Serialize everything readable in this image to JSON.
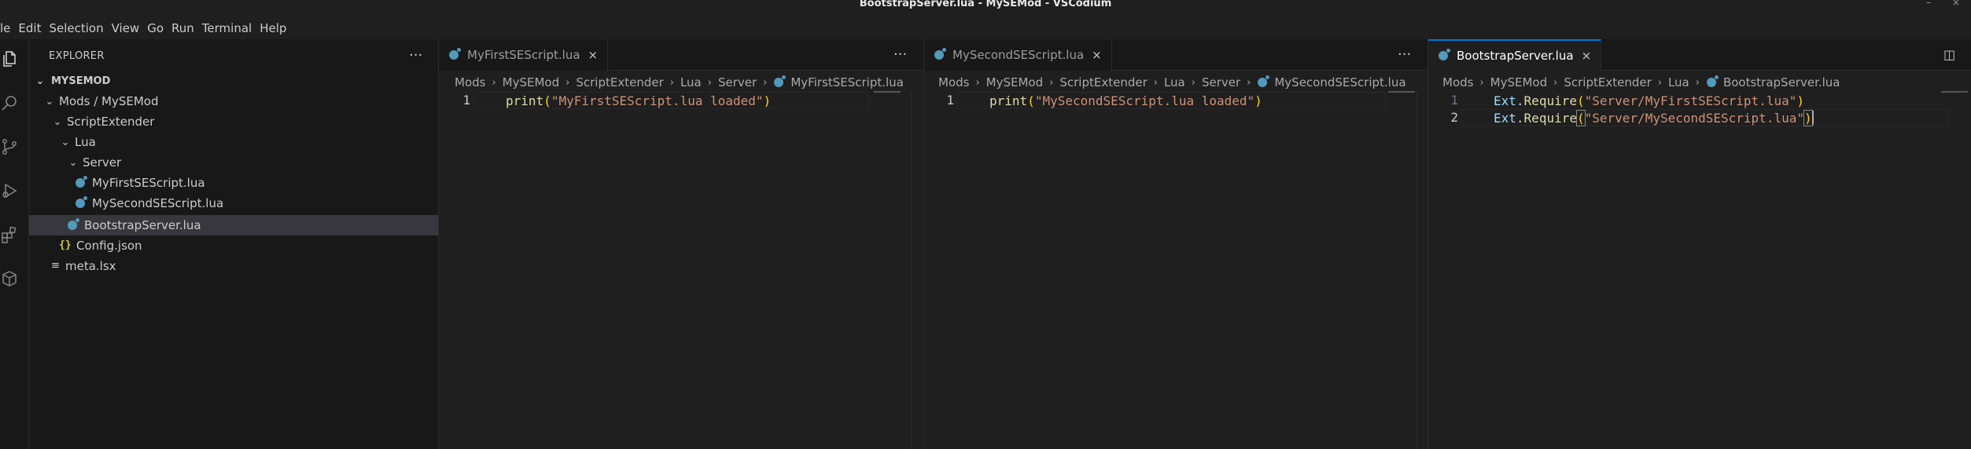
{
  "window": {
    "title": "BootstrapServer.lua - MySEMod - VSCodium",
    "minimize_glyph": "–",
    "close_glyph": "×"
  },
  "menu": [
    "le",
    "Edit",
    "Selection",
    "View",
    "Go",
    "Run",
    "Terminal",
    "Help"
  ],
  "activity_bar": [
    "files-icon",
    "search-icon",
    "source-control-icon",
    "run-debug-icon",
    "extensions-icon",
    "packages-icon"
  ],
  "explorer": {
    "header": "EXPLORER",
    "more": "···",
    "section": "MYSEMOD",
    "items": [
      {
        "label": "Mods / MySEMod",
        "type": "folder"
      },
      {
        "label": "ScriptExtender",
        "type": "folder"
      },
      {
        "label": "Lua",
        "type": "folder"
      },
      {
        "label": "Server",
        "type": "folder"
      },
      {
        "label": "MyFirstSEScript.lua",
        "type": "lua"
      },
      {
        "label": "MySecondSEScript.lua",
        "type": "lua"
      },
      {
        "label": "BootstrapServer.lua",
        "type": "lua",
        "selected": true
      },
      {
        "label": "Config.json",
        "type": "json",
        "icon_text": "{}"
      },
      {
        "label": "meta.lsx",
        "type": "lsx",
        "icon_text": "≡"
      }
    ]
  },
  "editors": [
    {
      "tab": "MyFirstSEScript.lua",
      "close": "×",
      "more": "···",
      "breadcrumbs": [
        "Mods",
        "MySEMod",
        "ScriptExtender",
        "Lua",
        "Server",
        "MyFirstSEScript.lua"
      ],
      "lines": [
        {
          "num": "1",
          "parts": [
            {
              "t": "print",
              "c": "fn"
            },
            {
              "t": "(",
              "c": "punc"
            },
            {
              "t": "\"MyFirstSEScript.lua loaded\"",
              "c": "str"
            },
            {
              "t": ")",
              "c": "punc"
            }
          ]
        }
      ]
    },
    {
      "tab": "MySecondSEScript.lua",
      "close": "×",
      "more": "···",
      "breadcrumbs": [
        "Mods",
        "MySEMod",
        "ScriptExtender",
        "Lua",
        "Server",
        "MySecondSEScript.lua"
      ],
      "lines": [
        {
          "num": "1",
          "parts": [
            {
              "t": "print",
              "c": "fn"
            },
            {
              "t": "(",
              "c": "punc"
            },
            {
              "t": "\"MySecondSEScript.lua loaded\"",
              "c": "str"
            },
            {
              "t": ")",
              "c": "punc"
            }
          ]
        }
      ]
    },
    {
      "tab": "BootstrapServer.lua",
      "close": "×",
      "split": "◫",
      "breadcrumbs": [
        "Mods",
        "MySEMod",
        "ScriptExtender",
        "Lua",
        "BootstrapServer.lua"
      ],
      "lines": [
        {
          "num": "1",
          "parts": [
            {
              "t": "Ext",
              "c": "ext"
            },
            {
              "t": ".",
              "c": "plain"
            },
            {
              "t": "Require",
              "c": "fn"
            },
            {
              "t": "(",
              "c": "punc"
            },
            {
              "t": "\"Server/MyFirstSEScript.lua\"",
              "c": "str"
            },
            {
              "t": ")",
              "c": "punc"
            }
          ]
        },
        {
          "num": "2",
          "parts": [
            {
              "t": "Ext",
              "c": "ext"
            },
            {
              "t": ".",
              "c": "plain"
            },
            {
              "t": "Require",
              "c": "fn"
            },
            {
              "t": "(",
              "c": "punc"
            },
            {
              "t": "\"Server/MySecondSEScript.lua\"",
              "c": "str"
            },
            {
              "t": ")",
              "c": "punc"
            }
          ]
        }
      ]
    }
  ]
}
